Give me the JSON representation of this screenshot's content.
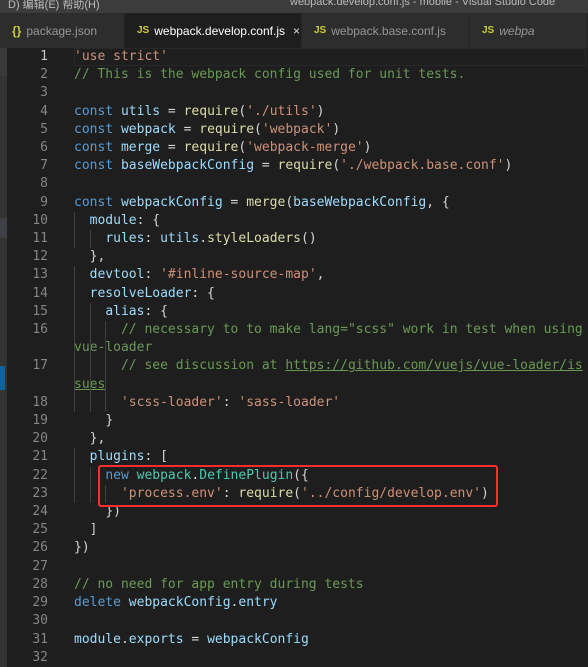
{
  "window": {
    "menu": "D)  编辑(E)   帮助(H)",
    "title": "webpack.develop.conf.js - mobile - Visual Studio Code"
  },
  "tabs": [
    {
      "label": "package.json",
      "icon": "json-braces-icon",
      "icon_text": "{}",
      "active": false
    },
    {
      "label": "webpack.develop.conf.js",
      "icon": "js-icon",
      "icon_text": "JS",
      "active": true,
      "close": "×"
    },
    {
      "label": "webpack.base.conf.js",
      "icon": "js-icon",
      "icon_text": "JS",
      "active": false
    },
    {
      "label": "webpa",
      "icon": "js-icon",
      "icon_text": "JS",
      "active": false,
      "preview": true
    }
  ],
  "colors": {
    "keyword": "#569cd6",
    "variable": "#9cdcfe",
    "string": "#ce9178",
    "comment": "#6a9955",
    "function": "#dcdcaa",
    "class": "#4ec9b0",
    "highlight_box": "#ff2d2d"
  },
  "editor": {
    "lines": [
      [
        [
          "str",
          "'use strict'"
        ]
      ],
      [
        [
          "com",
          "// This is the webpack config used for unit tests."
        ]
      ],
      [],
      [
        [
          "kw",
          "const"
        ],
        [
          "p",
          " "
        ],
        [
          "var",
          "utils"
        ],
        [
          "p",
          " = "
        ],
        [
          "fn",
          "require"
        ],
        [
          "p",
          "("
        ],
        [
          "str",
          "'./utils'"
        ],
        [
          "p",
          ")"
        ]
      ],
      [
        [
          "kw",
          "const"
        ],
        [
          "p",
          " "
        ],
        [
          "var",
          "webpack"
        ],
        [
          "p",
          " = "
        ],
        [
          "fn",
          "require"
        ],
        [
          "p",
          "("
        ],
        [
          "str",
          "'webpack'"
        ],
        [
          "p",
          ")"
        ]
      ],
      [
        [
          "kw",
          "const"
        ],
        [
          "p",
          " "
        ],
        [
          "var",
          "merge"
        ],
        [
          "p",
          " = "
        ],
        [
          "fn",
          "require"
        ],
        [
          "p",
          "("
        ],
        [
          "str",
          "'webpack-merge'"
        ],
        [
          "p",
          ")"
        ]
      ],
      [
        [
          "kw",
          "const"
        ],
        [
          "p",
          " "
        ],
        [
          "var",
          "baseWebpackConfig"
        ],
        [
          "p",
          " = "
        ],
        [
          "fn",
          "require"
        ],
        [
          "p",
          "("
        ],
        [
          "str",
          "'./webpack.base.conf'"
        ],
        [
          "p",
          ")"
        ]
      ],
      [],
      [
        [
          "kw",
          "const"
        ],
        [
          "p",
          " "
        ],
        [
          "var",
          "webpackConfig"
        ],
        [
          "p",
          " = "
        ],
        [
          "fn",
          "merge"
        ],
        [
          "p",
          "("
        ],
        [
          "var",
          "baseWebpackConfig"
        ],
        [
          "p",
          ", {"
        ]
      ],
      [
        [
          "p",
          "  "
        ],
        [
          "var",
          "module"
        ],
        [
          "p",
          ": {"
        ]
      ],
      [
        [
          "p",
          "    "
        ],
        [
          "var",
          "rules"
        ],
        [
          "p",
          ": "
        ],
        [
          "var",
          "utils"
        ],
        [
          "p",
          "."
        ],
        [
          "fn",
          "styleLoaders"
        ],
        [
          "p",
          "()"
        ]
      ],
      [
        [
          "p",
          "  },"
        ]
      ],
      [
        [
          "p",
          "  "
        ],
        [
          "var",
          "devtool"
        ],
        [
          "p",
          ": "
        ],
        [
          "str",
          "'#inline-source-map'"
        ],
        [
          "p",
          ","
        ]
      ],
      [
        [
          "p",
          "  "
        ],
        [
          "var",
          "resolveLoader"
        ],
        [
          "p",
          ": {"
        ]
      ],
      [
        [
          "p",
          "    "
        ],
        [
          "var",
          "alias"
        ],
        [
          "p",
          ": {"
        ]
      ],
      [
        [
          "p",
          "      "
        ],
        [
          "com",
          "// necessary to to make lang=\"scss\" work in test when using vue-loader"
        ]
      ],
      [
        [
          "p",
          "      "
        ],
        [
          "com",
          "// see discussion at "
        ],
        [
          "link",
          "https://github.com/vuejs/vue-loader/issues"
        ]
      ],
      [
        [
          "p",
          "      "
        ],
        [
          "str",
          "'scss-loader'"
        ],
        [
          "p",
          ": "
        ],
        [
          "str",
          "'sass-loader'"
        ]
      ],
      [
        [
          "p",
          "    }"
        ]
      ],
      [
        [
          "p",
          "  },"
        ]
      ],
      [
        [
          "p",
          "  "
        ],
        [
          "var",
          "plugins"
        ],
        [
          "p",
          ": ["
        ]
      ],
      [
        [
          "p",
          "    "
        ],
        [
          "kw",
          "new"
        ],
        [
          "p",
          " "
        ],
        [
          "cls",
          "webpack"
        ],
        [
          "p",
          "."
        ],
        [
          "cls",
          "DefinePlugin"
        ],
        [
          "p",
          "({"
        ]
      ],
      [
        [
          "p",
          "      "
        ],
        [
          "str",
          "'process.env'"
        ],
        [
          "p",
          ": "
        ],
        [
          "fn",
          "require"
        ],
        [
          "p",
          "("
        ],
        [
          "str",
          "'../config/develop.env'"
        ],
        [
          "p",
          ")"
        ]
      ],
      [
        [
          "p",
          "    })"
        ]
      ],
      [
        [
          "p",
          "  ]"
        ]
      ],
      [
        [
          "p",
          "})"
        ]
      ],
      [],
      [
        [
          "com",
          "// no need for app entry during tests"
        ]
      ],
      [
        [
          "kw",
          "delete"
        ],
        [
          "p",
          " "
        ],
        [
          "var",
          "webpackConfig"
        ],
        [
          "p",
          "."
        ],
        [
          "var",
          "entry"
        ]
      ],
      [],
      [
        [
          "var",
          "module"
        ],
        [
          "p",
          "."
        ],
        [
          "var",
          "exports"
        ],
        [
          "p",
          " = "
        ],
        [
          "var",
          "webpackConfig"
        ]
      ],
      []
    ]
  }
}
